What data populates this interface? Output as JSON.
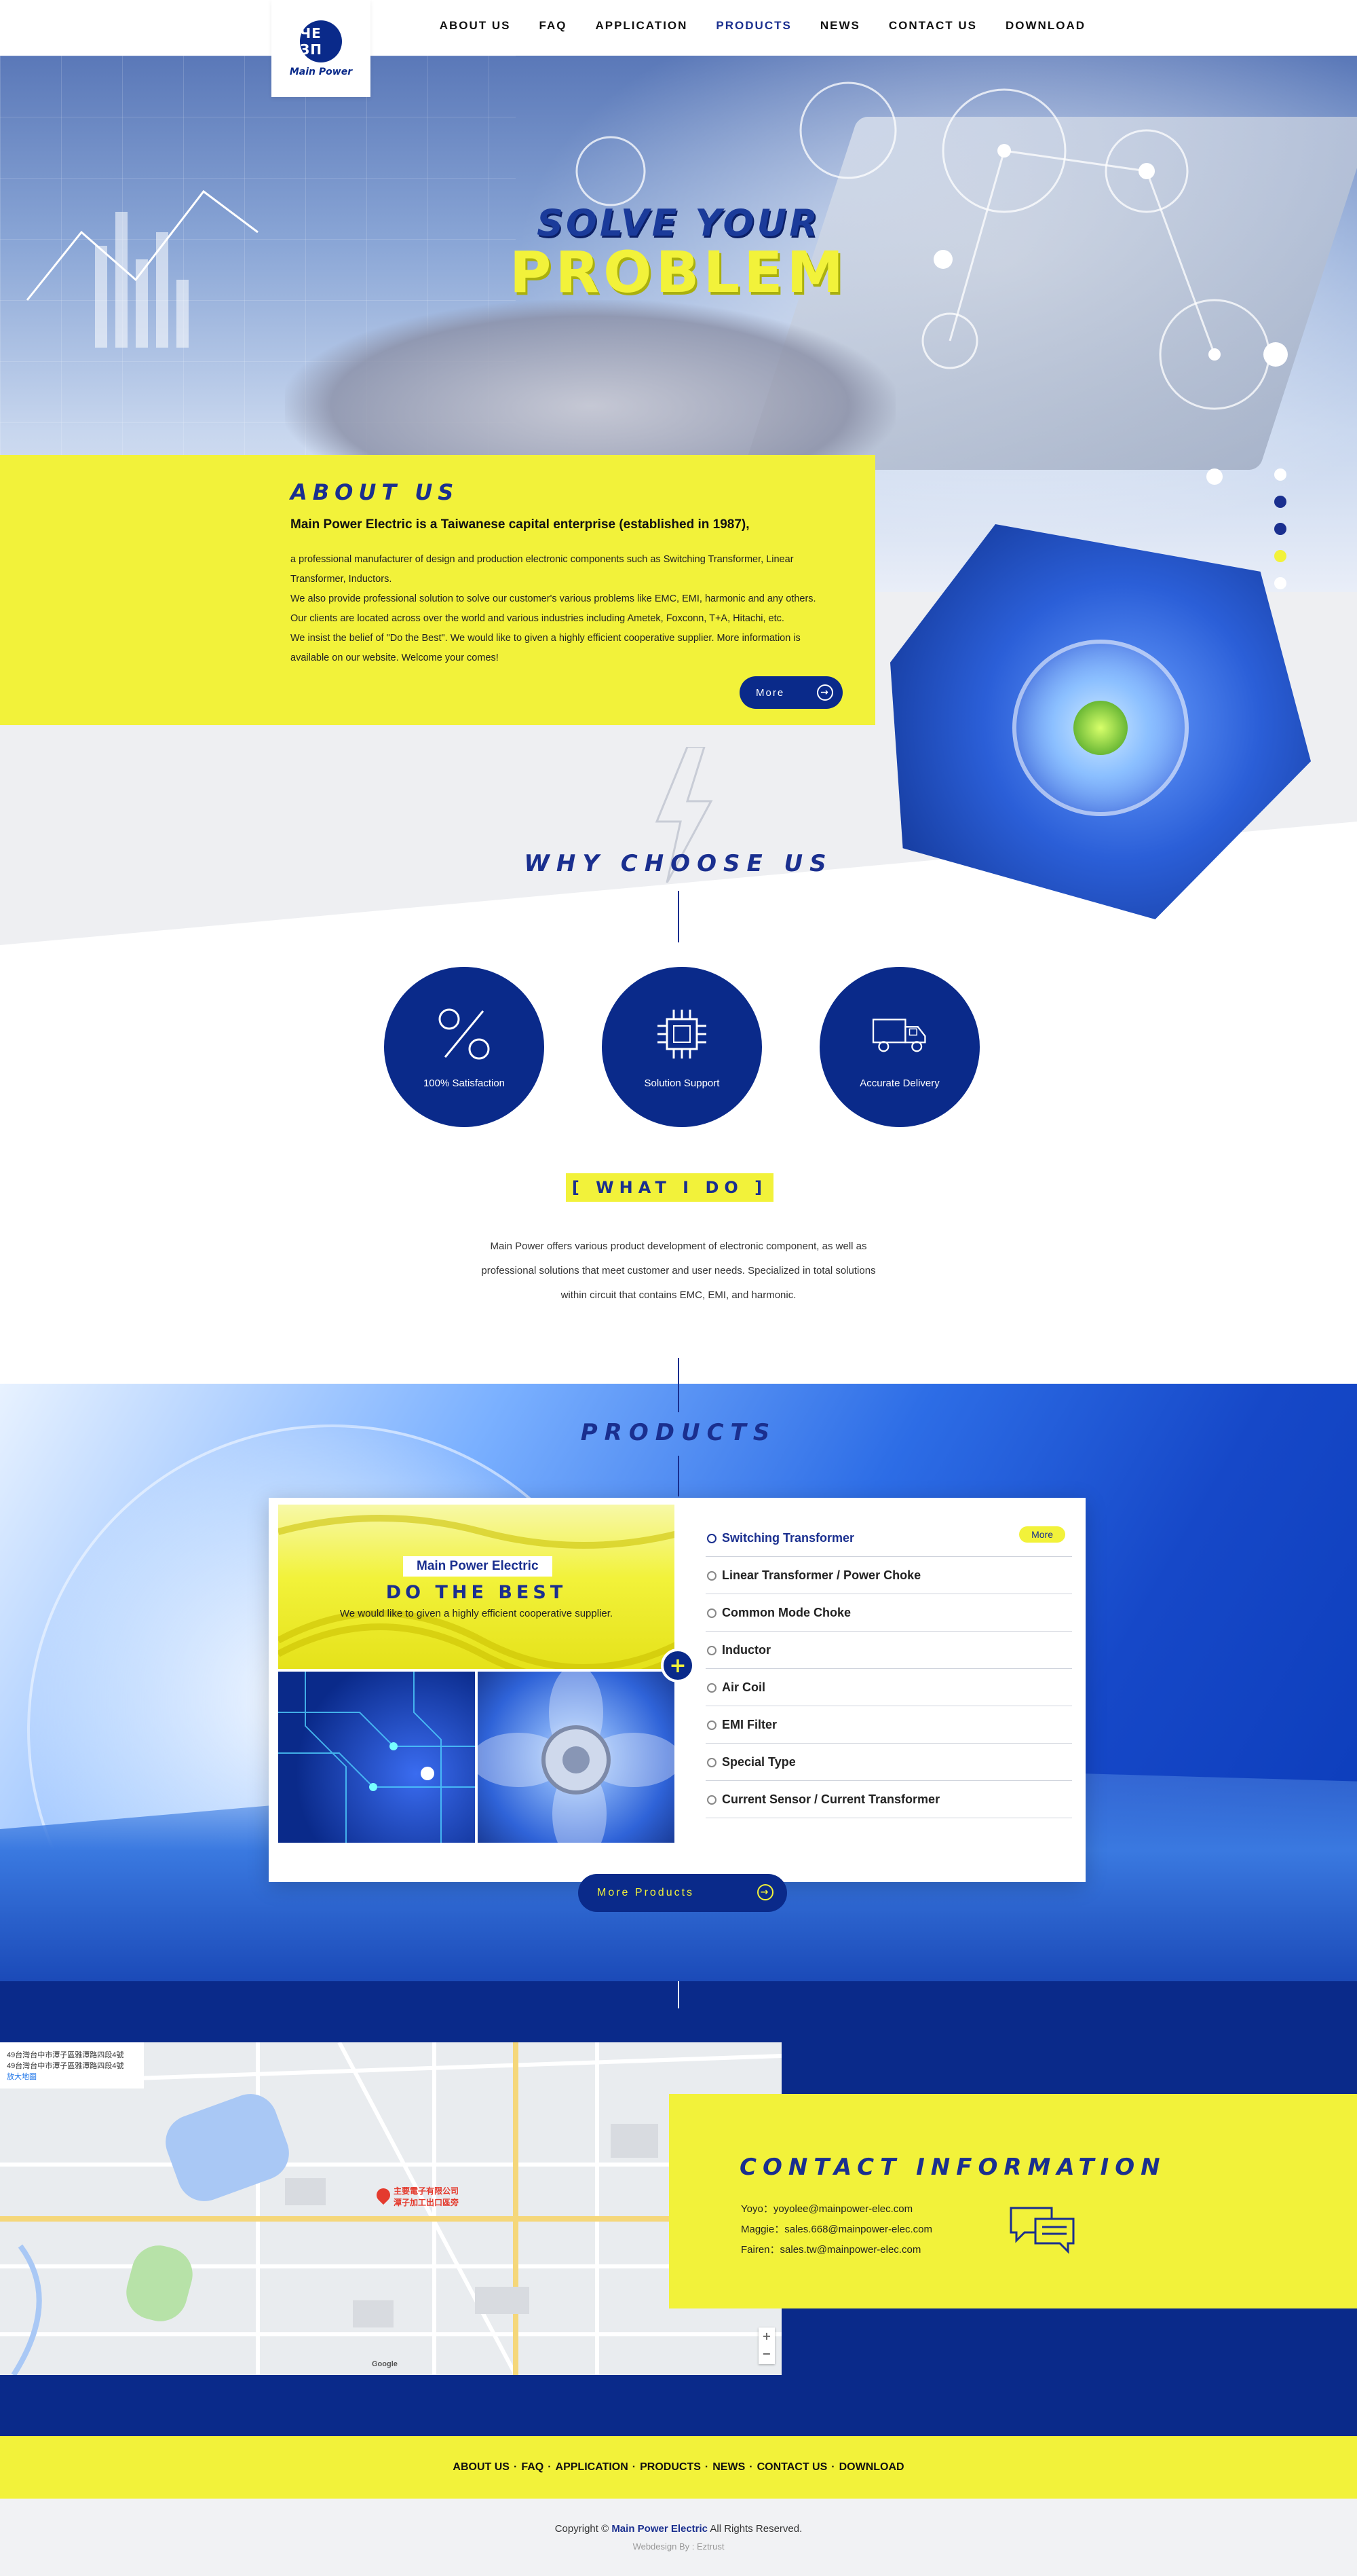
{
  "header": {
    "logo_mark": "ЧЕ ЗП",
    "logo_text": "Main Power",
    "nav": [
      "ABOUT US",
      "FAQ",
      "APPLICATION",
      "PRODUCTS",
      "NEWS",
      "CONTACT US",
      "DOWNLOAD"
    ],
    "active_nav": "PRODUCTS"
  },
  "hero": {
    "line1": "SOLVE YOUR",
    "line2": "PROBLEM",
    "slide_count": 5,
    "active_slide": 4
  },
  "about": {
    "title": "ABOUT US",
    "lead": "Main Power Electric is a Taiwanese capital enterprise (established in 1987),",
    "body": [
      "a professional manufacturer of design and production electronic components such as Switching Transformer, Linear",
      "Transformer, Inductors.",
      " We also provide professional solution to solve our customer's various problems like EMC, EMI, harmonic and any others.",
      "Our clients are located across over the world and various industries including Ametek, Foxconn, T+A, Hitachi, etc.",
      "We insist the belief of \"Do the Best\". We would like to given a highly efficient cooperative supplier. More information is",
      " available on our website. Welcome your comes!"
    ],
    "more_label": "More"
  },
  "why": {
    "title": "WHY CHOOSE US",
    "items": [
      {
        "label": "100% Satisfaction",
        "icon": "percent-icon"
      },
      {
        "label": "Solution Support",
        "icon": "chip-icon"
      },
      {
        "label": "Accurate Delivery",
        "icon": "truck-icon"
      }
    ]
  },
  "whatido": {
    "title": "[ WHAT I DO ]",
    "text": [
      "Main Power offers various product development of electronic component, as well as",
      "professional solutions that meet customer and user needs. Specialized in total solutions",
      "within circuit that contains EMC, EMI, and harmonic."
    ]
  },
  "products": {
    "title": "PRODUCTS",
    "banner_tag": "Main Power Electric",
    "banner_title": "DO THE BEST",
    "banner_sub": "We would like to given a highly efficient cooperative supplier.",
    "list": [
      "Switching Transformer",
      "Linear Transformer / Power Choke",
      "Common Mode Choke",
      "Inductor",
      "Air Coil",
      "EMI Filter",
      "Special Type",
      "Current Sensor / Current Transformer"
    ],
    "active_item": "Switching Transformer",
    "item_more_label": "More",
    "more_products_label": "More Products"
  },
  "map": {
    "info_line1": "49台灣台中市潭子區雅潭路四段4號",
    "info_line2": "49台灣台中市潭子區雅潭路四段4號",
    "link": "放大地圖",
    "pin_label1": "主要電子有限公司",
    "pin_label2": "潭子加工出口區旁",
    "google": "Google"
  },
  "contact": {
    "title": "CONTACT INFORMATION",
    "lines": [
      "Yoyo：yoyolee@mainpower-elec.com",
      "Maggie：sales.668@mainpower-elec.com",
      "Fairen：sales.tw@mainpower-elec.com"
    ]
  },
  "footer": {
    "nav": [
      "ABOUT US",
      "FAQ",
      "APPLICATION",
      "PRODUCTS",
      "NEWS",
      "CONTACT US",
      "DOWNLOAD"
    ],
    "copy_prefix": "Copyright ©",
    "copy_brand": "Main Power Electric",
    "copy_suffix": "All Rights Reserved.",
    "webdesign": "Webdesign By : Eztrust"
  },
  "colors": {
    "primary_blue": "#0a2a8a",
    "accent_yellow": "#f2f23a"
  }
}
